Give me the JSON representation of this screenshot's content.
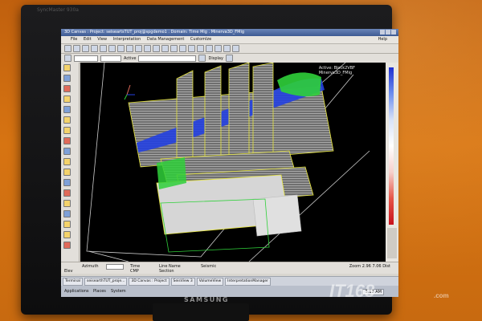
{
  "monitor": {
    "brand_top": "SyncMaster 930a",
    "brand_bottom": "SAMSUNG"
  },
  "watermark": {
    "text": "IT168",
    "sub": ".com"
  },
  "window": {
    "title": "3D Canvas : Project: seiseartsTUT_proj@spgdemo1 . Domain: Time Mig . Minerva3D_FMig",
    "menu": [
      "File",
      "Edit",
      "View",
      "Interpretation",
      "Data Management",
      "CustomIze"
    ],
    "help_label": "Help"
  },
  "toolbar2": {
    "active_label": "Active",
    "display_label": "Display"
  },
  "viewport": {
    "active_line1": "Active: Block2VBF",
    "active_line2": "Minerva3D_FMig"
  },
  "status": {
    "azimuth_label": "Azimuth",
    "elev_label": "Elev",
    "time_label": "Time",
    "cmp_label": "CMP",
    "line_name_label": "Line Name",
    "section_label": "Section",
    "seismic_label": "Seismic",
    "zoom_label": "Zoom",
    "zoom_value": "2.96",
    "dist_value": "7.06",
    "dist_label": "Dist"
  },
  "taskbar": {
    "tasks": [
      "Terminal",
      "seisearthTUT_proje...",
      "3D Canvas : Project",
      "SeisView 3",
      "VolumeView",
      "InterpretationManager"
    ],
    "apps": "Applications",
    "places": "Places",
    "system": "System",
    "clock": "3:12 AM"
  },
  "colors": {
    "screen_bg": "#000000",
    "seismic_gray": "#8a8a8a",
    "horizon_blue": "#2440e0",
    "horizon_green": "#2fd03a",
    "slice_outline": "#e6e43a"
  }
}
